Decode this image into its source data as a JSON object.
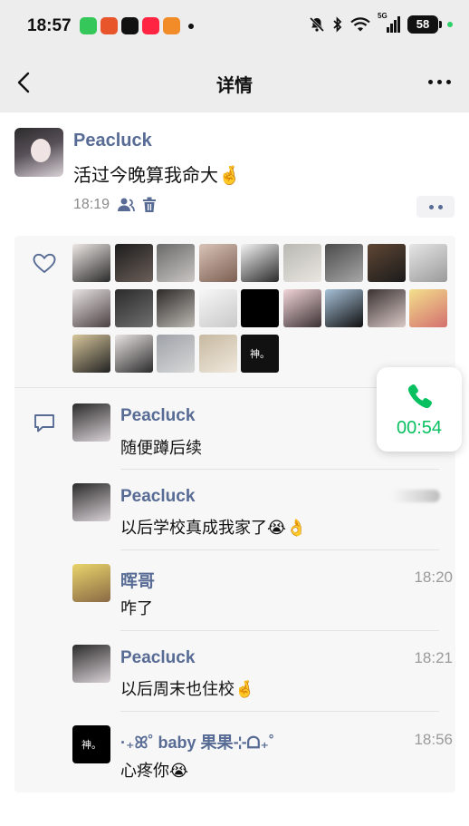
{
  "status_bar": {
    "time": "18:57",
    "network_label": "5G",
    "battery": "58",
    "app_icons": [
      "wechat-icon",
      "pumpkin-icon",
      "tiktok-icon",
      "xiaohongshu-icon",
      "game-icon"
    ],
    "app_colors": [
      "#35c759",
      "#e8552b",
      "#111111",
      "#ff2442",
      "#f28c28"
    ]
  },
  "nav": {
    "title": "详情"
  },
  "post": {
    "author": "Peacluck",
    "text": "活过今晚算我命大🤞",
    "time": "18:19"
  },
  "likes": {
    "avatars": [
      {
        "colors": [
          "#efe9e6",
          "#2b2b2b"
        ]
      },
      {
        "colors": [
          "#1c1c1c",
          "#6b5f59"
        ]
      },
      {
        "colors": [
          "#6a6a6a",
          "#c9c6c2"
        ]
      },
      {
        "colors": [
          "#d9c3b8",
          "#7c5f52"
        ]
      },
      {
        "colors": [
          "#f4f4f4",
          "#2a2a2a"
        ]
      },
      {
        "colors": [
          "#b9b8b3",
          "#e9e6e0"
        ]
      },
      {
        "colors": [
          "#4b4b4b",
          "#a7a7a7"
        ]
      },
      {
        "colors": [
          "#5f4634",
          "#1b1b1b"
        ]
      },
      {
        "colors": [
          "#e6e6e6",
          "#9a9a9a"
        ]
      },
      {
        "colors": [
          "#e9e4e4",
          "#4b4043"
        ]
      },
      {
        "colors": [
          "#2b2b2b",
          "#6f6f6f"
        ]
      },
      {
        "colors": [
          "#2e2a28",
          "#bcb8b3"
        ]
      },
      {
        "colors": [
          "#f7f7f7",
          "#c9c9c9"
        ]
      },
      {
        "colors": [
          "#000000",
          "#000000"
        ]
      },
      {
        "colors": [
          "#f2d5d8",
          "#3b3133"
        ]
      },
      {
        "colors": [
          "#a7c1d8",
          "#101010"
        ]
      },
      {
        "colors": [
          "#3a3232",
          "#d9c9c6"
        ]
      },
      {
        "colors": [
          "#f3e08c",
          "#d46f6f"
        ]
      },
      {
        "colors": [
          "#d8c79c",
          "#222222"
        ]
      },
      {
        "colors": [
          "#eae4e4",
          "#2c2c2c"
        ]
      },
      {
        "colors": [
          "#9ea2a8",
          "#d8d8d8"
        ]
      },
      {
        "colors": [
          "#c7b9a1",
          "#efe8dc"
        ]
      },
      {
        "colors": [
          "#111111",
          "#111111"
        ],
        "text": "神。"
      }
    ]
  },
  "comments": [
    {
      "name": "Peacluck",
      "text": "随便蹲后续",
      "time": "",
      "avatar_colors": [
        "#2b2b2b",
        "#d9d2d6"
      ]
    },
    {
      "name": "Peacluck",
      "text": "以后学校真成我家了😭👌",
      "time": "",
      "avatar_colors": [
        "#2b2b2b",
        "#d9d2d6"
      ]
    },
    {
      "name": "晖哥",
      "text": "咋了",
      "time": "18:20",
      "avatar_colors": [
        "#e9d46b",
        "#8a6a45"
      ]
    },
    {
      "name": "Peacluck",
      "text": "以后周末也住校🤞",
      "time": "18:21",
      "avatar_colors": [
        "#2b2b2b",
        "#d9d2d6"
      ]
    },
    {
      "name": "·₊ꕤ˚ baby 果果⊹ᗝ₊˚",
      "text": "心疼你😭",
      "time": "18:56",
      "avatar_colors": [
        "#000000",
        "#000000"
      ],
      "avatar_text": "神。"
    }
  ],
  "call": {
    "timer": "00:54",
    "color": "#07c160"
  },
  "colors": {
    "link_blue": "#576b95",
    "wechat_green": "#07c160"
  }
}
